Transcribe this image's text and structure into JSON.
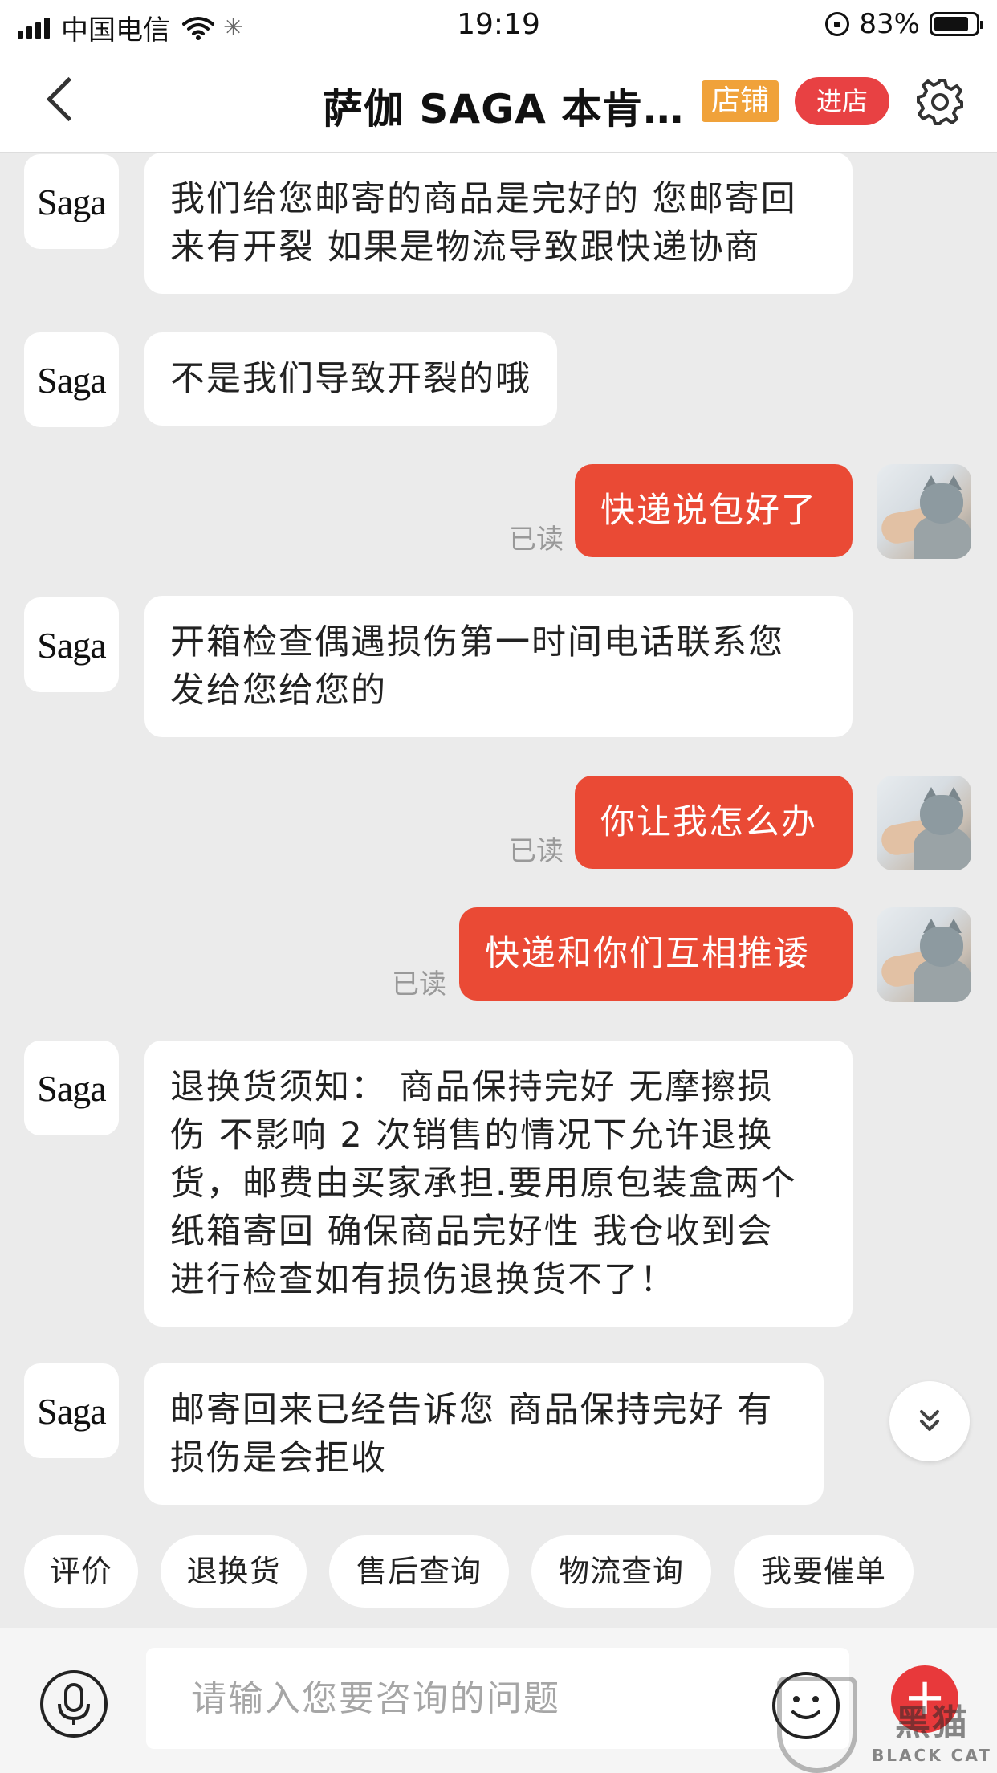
{
  "status_bar": {
    "carrier": "中国电信",
    "time": "19:19",
    "battery": "83%",
    "battery_level": 0.83
  },
  "header": {
    "title": "萨伽 SAGA 本肯…",
    "store_tag": "店铺",
    "enter_store": "进店"
  },
  "avatar_label": "Saga",
  "read_label": "已读",
  "messages": [
    {
      "from": "seller",
      "line1": "我们给您邮寄的商品是完好的 您邮寄回",
      "line2": "来有开裂 如果是物流导致跟快递协商"
    },
    {
      "from": "seller",
      "line1": "不是我们导致开裂的哦"
    },
    {
      "from": "me",
      "text": "快递说包好了"
    },
    {
      "from": "seller",
      "line1": "开箱检查偶遇损伤第一时间电话联系您",
      "line2": "发给您给您的"
    },
    {
      "from": "me",
      "text": "你让我怎么办"
    },
    {
      "from": "me",
      "text": "快递和你们互相推诿"
    },
    {
      "from": "seller",
      "line1": "退换货须知： 商品保持完好 无摩擦损",
      "line2": "伤 不影响 2 次销售的情况下允许退换",
      "line3": "货，邮费由买家承担.要用原包装盒两个",
      "line4": "纸箱寄回 确保商品完好性 我仓收到会",
      "line5": "进行检查如有损伤退换货不了！"
    },
    {
      "from": "seller",
      "line1": "邮寄回来已经告诉您 商品保持完好 有",
      "line2": "损伤是会拒收"
    }
  ],
  "quick_replies": [
    "评价",
    "退换货",
    "售后查询",
    "物流查询",
    "我要催单"
  ],
  "input": {
    "placeholder": "请输入您要咨询的问题",
    "value": ""
  },
  "watermark": {
    "main": "黑猫",
    "sub": "BLACK CAT"
  },
  "colors": {
    "accent_red": "#ea4a35",
    "store_tag": "#f0a23a",
    "enter_button": "#e84143",
    "chat_background": "#ebebeb"
  },
  "icons": [
    "back-icon",
    "settings-icon",
    "scroll-down-icon",
    "microphone-icon",
    "emoji-icon",
    "plus-icon"
  ]
}
